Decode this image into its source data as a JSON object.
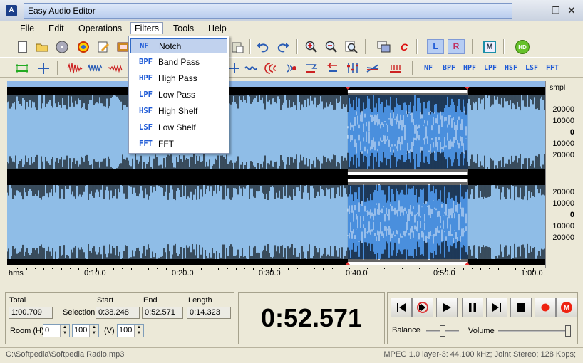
{
  "window": {
    "title": "Easy Audio Editor",
    "icon_label": "A"
  },
  "menu": [
    "File",
    "Edit",
    "Operations",
    "Filters",
    "Tools",
    "Help"
  ],
  "filters_menu": [
    {
      "code": "NF",
      "label": "Notch"
    },
    {
      "code": "BPF",
      "label": "Band Pass"
    },
    {
      "code": "HPF",
      "label": "High Pass"
    },
    {
      "code": "LPF",
      "label": "Low Pass"
    },
    {
      "code": "HSF",
      "label": "High Shelf"
    },
    {
      "code": "LSF",
      "label": "Low Shelf"
    },
    {
      "code": "FFT",
      "label": "FFT"
    }
  ],
  "toolbar1": {
    "left_channel": "L",
    "right_channel": "R",
    "m_button": "M",
    "hd_button": "HD",
    "c_button": "C"
  },
  "toolbar2_filters": [
    "NF",
    "BPF",
    "HPF",
    "LPF",
    "HSF",
    "LSF",
    "FFT"
  ],
  "waveform": {
    "unit": "smpl",
    "channel1_labels": [
      "20000",
      "10000",
      "0",
      "10000",
      "20000"
    ],
    "channel2_labels": [
      "20000",
      "10000",
      "0",
      "10000",
      "20000"
    ],
    "selection_fraction": [
      0.633,
      0.855
    ],
    "colors": {
      "unselected": "#8fbde7",
      "selected": "#4a8fdd",
      "wave": "#000000",
      "background": "#000000",
      "selection_bg": "#ffffff"
    }
  },
  "timeline": {
    "unit": "hms",
    "labels": [
      "0:10.0",
      "0:20.0",
      "0:30.0",
      "0:40.0",
      "0:50.0",
      "1:00.0"
    ]
  },
  "info": {
    "total_label": "Total",
    "total_value": "1:00.709",
    "selection_label": "Selection",
    "start_label": "Start",
    "start_value": "0:38.248",
    "end_label": "End",
    "end_value": "0:52.571",
    "length_label": "Length",
    "length_value": "0:14.323",
    "room_h_label": "Room (H)",
    "room_h_value": "0",
    "room_h_value2": "100",
    "room_v_label": "(V)",
    "room_v_value": "100"
  },
  "current_time": "0:52.571",
  "controls": {
    "balance_label": "Balance",
    "volume_label": "Volume",
    "balance_level": 0.5,
    "volume_level": 1.0
  },
  "status": {
    "file_path": "C:\\Softpedia\\Softpedia Radio.mp3",
    "format": "MPEG 1.0 layer-3: 44,100 kHz; Joint Stereo; 128 Kbps;"
  }
}
